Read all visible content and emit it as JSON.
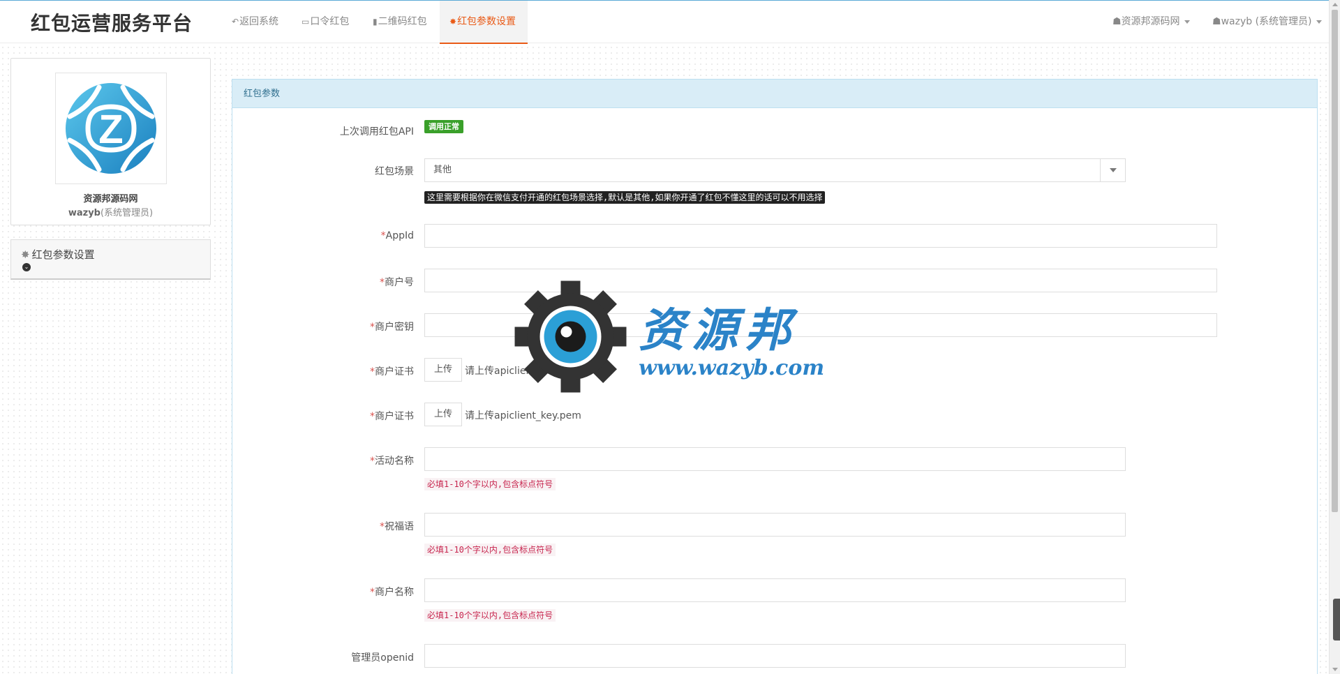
{
  "navbar": {
    "brand": "红包运营服务平台",
    "items": [
      {
        "icon": "reply-icon",
        "label": "返回系统"
      },
      {
        "icon": "card-icon",
        "label": "口令红包"
      },
      {
        "icon": "qrcode-icon",
        "label": "二维码红包"
      },
      {
        "icon": "gear-icon",
        "label": "红包参数设置",
        "active": true
      }
    ],
    "right": {
      "org": "资源邦源码网",
      "user": "wazyb (系统管理员)"
    }
  },
  "sidebar": {
    "profile_name": "资源邦源码网",
    "profile_user": "wazyb",
    "profile_role": "(系统管理员)",
    "menu_title": "红包参数设置"
  },
  "panel": {
    "heading": "红包参数",
    "fields": {
      "last_call": {
        "label": "上次调用红包API",
        "status": "调用正常"
      },
      "scene": {
        "label": "红包场景",
        "value": "其他",
        "tip": "这里需要根据你在微信支付开通的红包场景选择,默认是其他,如果你开通了红包不懂这里的话可以不用选择"
      },
      "appid": {
        "label": "AppId",
        "value": ""
      },
      "mch_id": {
        "label": "商户号",
        "value": ""
      },
      "mch_key": {
        "label": "商户密钥",
        "value": ""
      },
      "cert1": {
        "label": "商户证书",
        "button": "上传",
        "hint": "请上传apiclient_cert.pem"
      },
      "cert2": {
        "label": "商户证书",
        "button": "上传",
        "hint": "请上传apiclient_key.pem"
      },
      "act_name": {
        "label": "活动名称",
        "value": "",
        "tip": "必填1-10个字以内,包含标点符号"
      },
      "wishing": {
        "label": "祝福语",
        "value": "",
        "tip": "必填1-10个字以内,包含标点符号"
      },
      "send_name": {
        "label": "商户名称",
        "value": "",
        "tip": "必填1-10个字以内,包含标点符号"
      },
      "openid": {
        "label": "管理员openid",
        "value": ""
      }
    },
    "required_mark": "*"
  },
  "watermark": {
    "text": "资源邦",
    "url": "www.wazyb.com"
  },
  "colors": {
    "accent": "#e95a16",
    "panel_heading": "#d9edf7",
    "ok": "#3aa02a",
    "logo": "#2b9fd6"
  }
}
